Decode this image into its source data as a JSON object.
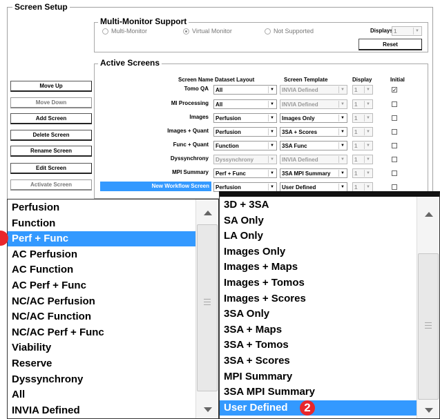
{
  "panel": {
    "title": "Screen Setup"
  },
  "multi": {
    "title": "Multi-Monitor Support",
    "options": [
      {
        "label": "Multi-Monitor",
        "selected": false
      },
      {
        "label": "Virtual Monitor",
        "selected": true
      },
      {
        "label": "Not Supported",
        "selected": false
      }
    ],
    "displays_label": "Displays",
    "displays_value": "1",
    "reset_label": "Reset"
  },
  "active": {
    "title": "Active Screens",
    "headers": {
      "name": "Screen Name",
      "layout": "Dataset Layout",
      "template": "Screen Template",
      "display": "Display",
      "initial": "Initial"
    },
    "rows": [
      {
        "name": "Tomo QA",
        "layout": "All",
        "layout_enabled": true,
        "template": "INVIA Defined",
        "template_enabled": false,
        "display": "1",
        "initial": true
      },
      {
        "name": "MI Processing",
        "layout": "All",
        "layout_enabled": true,
        "template": "INVIA Defined",
        "template_enabled": false,
        "display": "1",
        "initial": false
      },
      {
        "name": "Images",
        "layout": "Perfusion",
        "layout_enabled": true,
        "template": "Images Only",
        "template_enabled": true,
        "display": "1",
        "initial": false
      },
      {
        "name": "Images + Quant",
        "layout": "Perfusion",
        "layout_enabled": true,
        "template": "3SA + Scores",
        "template_enabled": true,
        "display": "1",
        "initial": false
      },
      {
        "name": "Func + Quant",
        "layout": "Function",
        "layout_enabled": true,
        "template": "3SA Func",
        "template_enabled": true,
        "display": "1",
        "initial": false
      },
      {
        "name": "Dyssynchrony",
        "layout": "Dyssynchrony",
        "layout_enabled": false,
        "template": "INVIA Defined",
        "template_enabled": false,
        "display": "1",
        "initial": false
      },
      {
        "name": "MPI Summary",
        "layout": "Perf + Func",
        "layout_enabled": true,
        "template": "3SA MPI Summary",
        "template_enabled": true,
        "display": "1",
        "initial": false
      },
      {
        "name": "New Workflow Screen",
        "layout": "Perfusion",
        "layout_enabled": true,
        "template": "User Defined",
        "template_enabled": true,
        "display": "1",
        "initial": false
      }
    ]
  },
  "buttons": [
    {
      "label": "Move Up",
      "enabled": true
    },
    {
      "label": "Move Down",
      "enabled": false
    },
    {
      "label": "Add Screen",
      "enabled": true
    },
    {
      "label": "Delete Screen",
      "enabled": true
    },
    {
      "label": "Rename Screen",
      "enabled": true
    },
    {
      "label": "Edit Screen",
      "enabled": true
    },
    {
      "label": "Activate Screen",
      "enabled": false
    }
  ],
  "layout_list": {
    "items": [
      "Perfusion",
      "Function",
      "Perf + Func",
      "AC Perfusion",
      "AC Function",
      "AC Perf + Func",
      "NC/AC Perfusion",
      "NC/AC Function",
      "NC/AC Perf + Func",
      "Viability",
      "Reserve",
      "Dyssynchrony",
      "All",
      "INVIA Defined"
    ],
    "selected_index": 2
  },
  "template_list": {
    "items": [
      "3D + 3SA",
      "SA Only",
      "LA Only",
      "Images Only",
      "Images + Maps",
      "Images + Tomos",
      "Images + Scores",
      "3SA Only",
      "3SA + Maps",
      "3SA + Tomos",
      "3SA + Scores",
      "MPI Summary",
      "3SA MPI Summary",
      "User Defined"
    ],
    "selected_index": 13,
    "badge": "2"
  },
  "colors": {
    "selection": "#3399ff",
    "badge": "#e8262b"
  },
  "icons": {
    "scroll_up": "scroll-up-icon",
    "scroll_down": "scroll-down-icon",
    "grip": "grip-icon",
    "dropdown": "chevron-down-icon"
  }
}
